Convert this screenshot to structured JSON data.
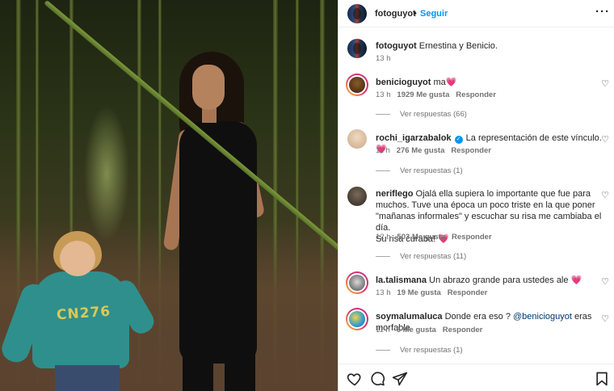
{
  "post": {
    "author": "fotoguyot",
    "follow_label": "Seguir",
    "separator": "•",
    "more_icon": "more-horizontal-icon"
  },
  "caption": {
    "username": "fotoguyot",
    "text": "Ernestina y Benicio.",
    "time": "13 h"
  },
  "photo": {
    "shirt_text": "CN276"
  },
  "comments": [
    {
      "username": "benicioguyot",
      "text": "ma",
      "heart": "💗",
      "time": "13 h",
      "likes": "1929 Me gusta",
      "reply": "Responder",
      "view_replies": "Ver respuestas (66)"
    },
    {
      "username": "rochi_igarzabalok",
      "verified_icon": "✓",
      "text": "La representación de este vínculo.",
      "heart": "💗",
      "time": "11 h",
      "likes": "276 Me gusta",
      "reply": "Responder",
      "view_replies": "Ver respuestas (1)"
    },
    {
      "username": "neriflego",
      "text_line1": "Ojalá ella supiera lo importante que fue para",
      "text_line2": "muchos. Tuve una época un poco triste en la que poner",
      "text_line3": "\"mañanas informales\" y escuchar su risa me cambiaba el día.",
      "text_line4": "Su risa curaba!",
      "heart": "💗",
      "time": "12 h",
      "likes": "503 Me gusta",
      "reply": "Responder",
      "view_replies": "Ver respuestas (11)"
    },
    {
      "username": "la.talismana",
      "text": "Un abrazo grande para ustedes ale",
      "heart": "💗",
      "time": "13 h",
      "likes": "19 Me gusta",
      "reply": "Responder"
    },
    {
      "username": "soymalumaluca",
      "text": "Donde era eso ?",
      "mention": "@benicioguyot",
      "text_after": "eras morfable",
      "time": "11 h",
      "likes": "5 Me gusta",
      "reply": "Responder",
      "view_replies": "Ver respuestas (1)"
    }
  ],
  "actions": {
    "like_icon": "heart-outline-icon",
    "comment_icon": "comment-icon",
    "share_icon": "share-icon",
    "save_icon": "bookmark-icon"
  }
}
